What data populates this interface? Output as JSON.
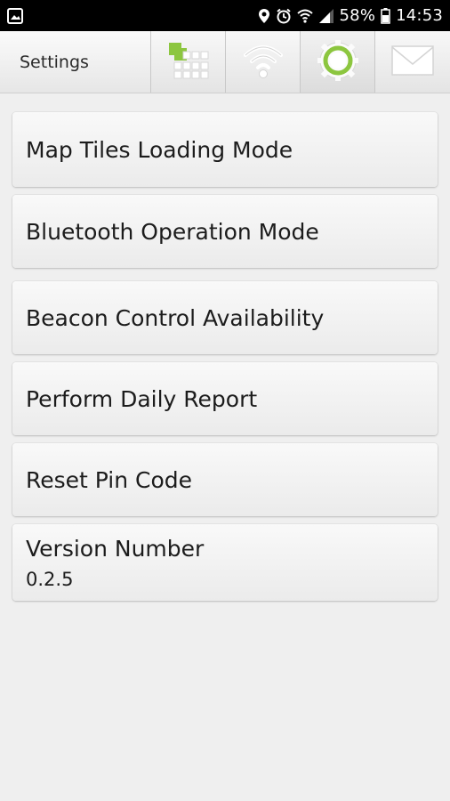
{
  "status_bar": {
    "battery_percent": "58%",
    "time": "14:53",
    "icons": [
      "image-icon",
      "location-icon",
      "alarm-icon",
      "wifi-icon",
      "signal-icon",
      "battery-icon"
    ]
  },
  "header": {
    "title": "Settings",
    "tabs": [
      {
        "name": "map-grid-icon"
      },
      {
        "name": "wifi-icon"
      },
      {
        "name": "settings-gear-icon"
      },
      {
        "name": "mail-icon"
      }
    ],
    "accent_color": "#8cc63f"
  },
  "settings": {
    "items": [
      {
        "label": "Map Tiles Loading Mode"
      },
      {
        "label": "Bluetooth Operation Mode"
      },
      {
        "label": "Beacon Control Availability"
      },
      {
        "label": "Perform Daily Report"
      },
      {
        "label": "Reset Pin Code"
      },
      {
        "label": "Version Number",
        "value": "0.2.5"
      }
    ]
  }
}
